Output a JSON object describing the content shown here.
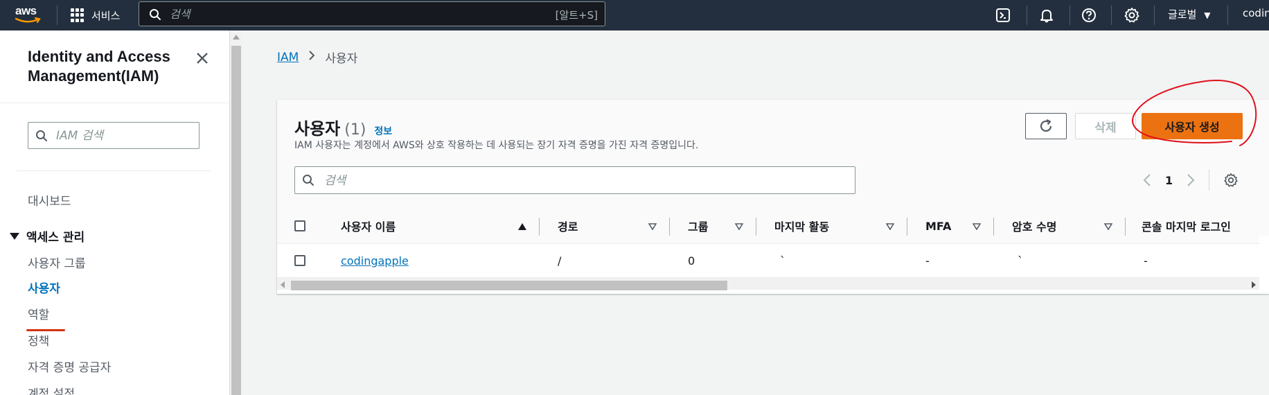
{
  "topnav": {
    "logo": "aws",
    "services_label": "서비스",
    "search_placeholder": "검색",
    "search_shortcut": "[알트+S]",
    "icons": [
      "cloudshell-icon",
      "bell-icon",
      "help-icon",
      "gear-icon"
    ],
    "region_label": "글로벌",
    "account_label": "codin"
  },
  "sidebar": {
    "title": "Identity and Access Management(IAM)",
    "search_placeholder": "IAM 검색",
    "dashboard": "대시보드",
    "section": "액세스 관리",
    "items": [
      "사용자 그룹",
      "사용자",
      "역할",
      "정책",
      "자격 증명 공급자",
      "계정 설정"
    ],
    "active_item": "사용자"
  },
  "breadcrumb": {
    "root": "IAM",
    "current": "사용자"
  },
  "panel": {
    "title": "사용자",
    "count": "(1)",
    "info_link": "정보",
    "description": "IAM 사용자는 계정에서 AWS와 상호 작용하는 데 사용되는 장기 자격 증명을 가진 자격 증명입니다.",
    "delete_label": "삭제",
    "create_label": "사용자 생성",
    "search_placeholder": "검색",
    "page_number": "1"
  },
  "table": {
    "columns": [
      "사용자 이름",
      "경로",
      "그룹",
      "마지막 활동",
      "MFA",
      "암호 수명",
      "콘솔 마지막 로그인"
    ],
    "rows": [
      {
        "user_name": "codingapple",
        "path": "/",
        "groups": "0",
        "last_activity": "`",
        "mfa": "-",
        "password_age": "`",
        "console_last_login": "-"
      }
    ]
  },
  "colors": {
    "nav_bg": "#232f3e",
    "accent_orange": "#ec7211",
    "link_blue": "#0073bb",
    "annotation_red": "#e0101a"
  }
}
